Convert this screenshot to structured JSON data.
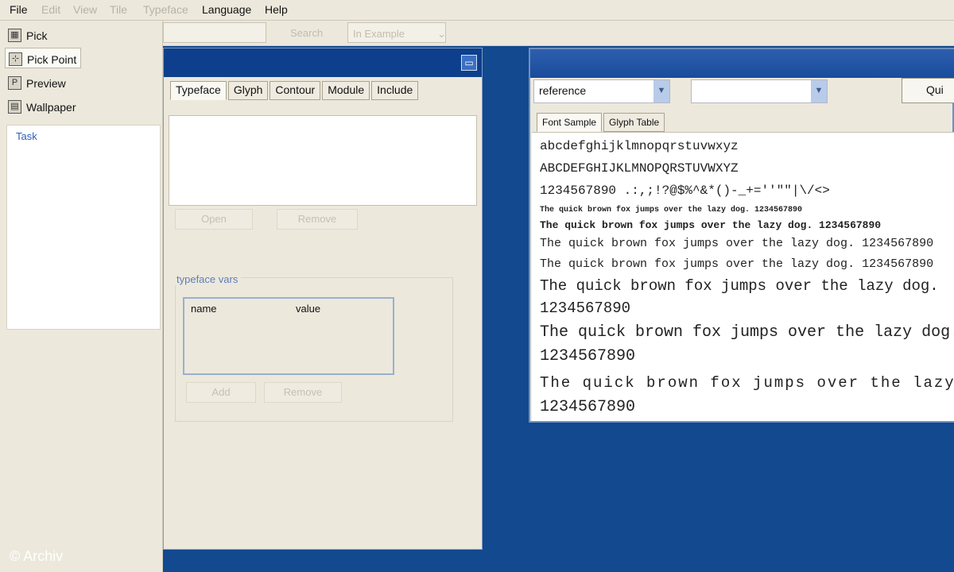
{
  "menubar": {
    "items": [
      "File",
      "Edit",
      "View",
      "Tile",
      "Typeface",
      "Language",
      "Help"
    ]
  },
  "toolbar": {
    "search_label": "Search",
    "search_scope": "In Example"
  },
  "tools": [
    {
      "label": "Pick",
      "icon": "pick-icon"
    },
    {
      "label": "Pick Point",
      "icon": "pick-point-icon"
    },
    {
      "label": "Preview",
      "icon": "preview-icon"
    },
    {
      "label": "Wallpaper",
      "icon": "wallpaper-icon"
    }
  ],
  "task_panel": {
    "label": "Task"
  },
  "typeface_dialog": {
    "tabs": [
      "Typeface",
      "Glyph",
      "Contour",
      "Module",
      "Include"
    ],
    "active_tab": "Typeface",
    "open_button": "Open",
    "remove_button": "Remove",
    "group_label": "typeface vars",
    "columns": [
      "name",
      "value"
    ],
    "add_button": "Add",
    "remove_var_button": "Remove"
  },
  "preview_window": {
    "font_combo_value": "reference",
    "size_combo_value": "",
    "quit_button": "Qui",
    "tabs": [
      "Font Sample",
      "Glyph Table"
    ],
    "active_tab": "Font Sample",
    "sample": {
      "lowercase": "abcdefghijklmnopqrstuvwxyz",
      "uppercase": "ABCDEFGHIJKLMNOPQRSTUVWXYZ",
      "digits_symbols": "1234567890 .:,;!?@$%^&*()-_+=''\"\"|\\/<>",
      "pangram_xs": "The quick brown fox jumps over the lazy dog. 1234567890",
      "pangram_s": "The quick brown fox jumps over the lazy dog. 1234567890",
      "pangram_m": "The quick brown fox jumps over the lazy dog. 1234567890",
      "pangram_m2": "The quick brown fox jumps over the lazy dog. 1234567890",
      "pangram_l": "The quick brown fox jumps over the lazy dog.",
      "digits_l": "1234567890",
      "pangram_xl": "The quick brown fox jumps over the lazy dog.",
      "digits_xl": "1234567890",
      "pangram_xxl": "The quick brown fox jumps over the lazy dog.",
      "digits_xxl": "1234567890"
    }
  },
  "watermark": "© Archiv"
}
